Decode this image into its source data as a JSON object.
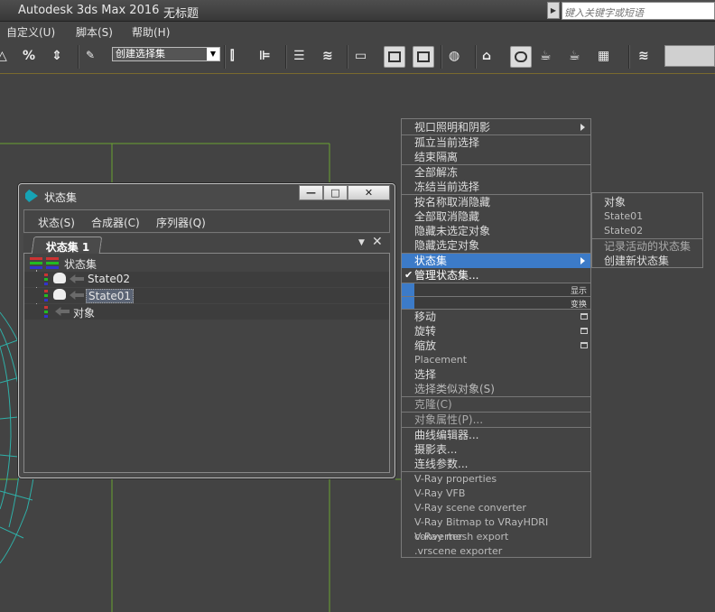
{
  "titlebar": {
    "app_title": "Autodesk 3ds Max 2016",
    "doc_title": "无标题",
    "search_placeholder": "键入关键字或短语"
  },
  "menubar": {
    "items": [
      "自定义(U)",
      "脚本(S)",
      "帮助(H)"
    ]
  },
  "toolbar": {
    "named_selection_set": "创建选择集",
    "percent_snap_label": "%"
  },
  "dialog": {
    "title": "状态集",
    "menu": [
      "状态(S)",
      "合成器(C)",
      "序列器(Q)"
    ],
    "tab": "状态集 1",
    "tree": {
      "root": "状态集",
      "children": [
        "State02",
        "State01"
      ],
      "objects": "对象"
    },
    "selected_item": "State01"
  },
  "quad_menu": {
    "items": [
      {
        "label": "视口照明和阴影",
        "submenu": true
      },
      {
        "label": "孤立当前选择"
      },
      {
        "label": "结束隔离"
      },
      {
        "label": "全部解冻"
      },
      {
        "label": "冻结当前选择"
      },
      {
        "label": "按名称取消隐藏"
      },
      {
        "label": "全部取消隐藏"
      },
      {
        "label": "隐藏未选定对象"
      },
      {
        "label": "隐藏选定对象"
      },
      {
        "label": "状态集",
        "highlighted": true,
        "submenu": true
      },
      {
        "label": "管理状态集...",
        "checked": true
      },
      {
        "label": "显示"
      },
      {
        "label": "变换"
      },
      {
        "label": "移动"
      },
      {
        "label": "旋转"
      },
      {
        "label": "缩放"
      },
      {
        "label": "Placement"
      },
      {
        "label": "选择"
      },
      {
        "label": "选择类似对象(S)"
      },
      {
        "label": "克隆(C)"
      },
      {
        "label": "对象属性(P)..."
      },
      {
        "label": "曲线编辑器..."
      },
      {
        "label": "摄影表..."
      },
      {
        "label": "连线参数..."
      },
      {
        "label": "V-Ray properties"
      },
      {
        "label": "V-Ray VFB"
      },
      {
        "label": "V-Ray scene converter"
      },
      {
        "label": "V-Ray Bitmap to VRayHDRI converter"
      },
      {
        "label": "V-Ray mesh export"
      },
      {
        "label": ".vrscene exporter"
      }
    ]
  },
  "submenu": {
    "items": [
      "对象",
      "State01",
      "State02",
      "记录活动的状态集",
      "创建新状态集"
    ]
  }
}
